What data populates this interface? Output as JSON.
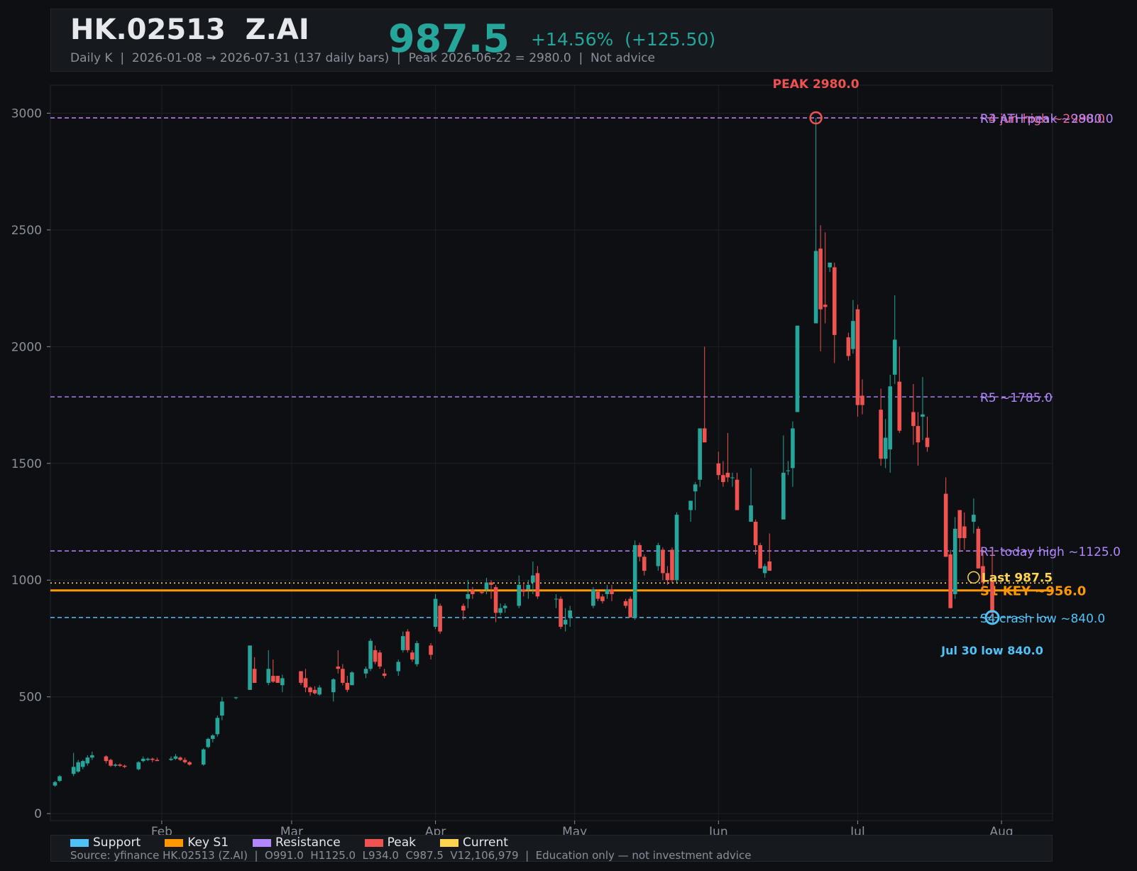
{
  "header": {
    "ticker": "HK.02513  Z.AI",
    "price": "987.5",
    "change": "+14.56%  (+125.50)",
    "subtitle": "Daily K  |  2026-01-08 → 2026-07-31 (137 daily bars)  |  Peak 2026-06-22 = 2980.0  |  Not advice"
  },
  "colors": {
    "background": "#0d0f13",
    "panel": "#16191e",
    "up": "#26a69a",
    "down": "#ef5350",
    "support": "#4fc3f7",
    "key_s1": "#ff9800",
    "resistance": "#b388ff",
    "peak": "#ef5350",
    "current": "#ffd54f",
    "r_high": "#f06292"
  },
  "chart_data": {
    "type": "candlestick",
    "x_range": [
      "2026-01-08",
      "2026-08-12"
    ],
    "ylim": [
      -30,
      3120
    ],
    "yticks": [
      0,
      500,
      1000,
      1500,
      2000,
      2500,
      3000
    ],
    "xticks": [
      {
        "date": "2026-02-01",
        "label": "Feb"
      },
      {
        "date": "2026-03-01",
        "label": "Mar"
      },
      {
        "date": "2026-04-01",
        "label": "Apr"
      },
      {
        "date": "2026-05-01",
        "label": "May"
      },
      {
        "date": "2026-06-01",
        "label": "Jun"
      },
      {
        "date": "2026-07-01",
        "label": "Jul"
      },
      {
        "date": "2026-08-01",
        "label": "Aug"
      }
    ],
    "grid": true,
    "hlines": [
      {
        "label": "R4 jun high ~2980.0",
        "value": 2980,
        "color": "#f06292",
        "style": "dashed"
      },
      {
        "label": "R3 ATH peak ~2980.0",
        "value": 2980,
        "color": "#b388ff",
        "style": "dashed"
      },
      {
        "label": "R5 ~1785.0",
        "value": 1785,
        "color": "#b388ff",
        "style": "dashed"
      },
      {
        "label": "R1 today high ~1125.0",
        "value": 1125,
        "color": "#b388ff",
        "style": "dashed"
      },
      {
        "label": "S1 KEY ~956.0",
        "value": 956,
        "color": "#ff9800",
        "style": "solid"
      },
      {
        "label": "S4 crash low ~840.0",
        "value": 840,
        "color": "#4fc3f7",
        "style": "dashed"
      },
      {
        "label": "",
        "value": 987.5,
        "color": "#ffd54f",
        "style": "dotted"
      }
    ],
    "annotations": [
      {
        "text": "PEAK 2980.0",
        "date": "2026-06-22",
        "value": 2980,
        "color": "#ef5350"
      },
      {
        "text": "Jul 30 low 840.0",
        "date": "2026-07-30",
        "value": 840,
        "color": "#4fc3f7"
      },
      {
        "text": "Last 987.5",
        "date": "2026-07-26",
        "value": 987.5,
        "color": "#ffd54f"
      }
    ],
    "candles": [
      [
        "2026-01-09",
        120,
        140,
        115,
        135
      ],
      [
        "2026-01-10",
        140,
        165,
        135,
        160
      ],
      [
        "2026-01-13",
        170,
        260,
        160,
        200
      ],
      [
        "2026-01-14",
        180,
        230,
        175,
        220
      ],
      [
        "2026-01-15",
        200,
        230,
        190,
        225
      ],
      [
        "2026-01-16",
        215,
        250,
        205,
        240
      ],
      [
        "2026-01-17",
        240,
        265,
        230,
        250
      ],
      [
        "2026-01-20",
        245,
        250,
        215,
        225
      ],
      [
        "2026-01-21",
        230,
        235,
        200,
        205
      ],
      [
        "2026-01-22",
        205,
        215,
        200,
        210
      ],
      [
        "2026-01-23",
        210,
        215,
        200,
        205
      ],
      [
        "2026-01-24",
        205,
        210,
        195,
        200
      ],
      [
        "2026-01-27",
        190,
        225,
        185,
        220
      ],
      [
        "2026-01-28",
        225,
        245,
        220,
        235
      ],
      [
        "2026-01-29",
        230,
        240,
        225,
        235
      ],
      [
        "2026-01-30",
        235,
        240,
        220,
        230
      ],
      [
        "2026-01-31",
        230,
        240,
        225,
        225
      ],
      [
        "2026-02-03",
        230,
        245,
        225,
        235
      ],
      [
        "2026-02-04",
        235,
        255,
        230,
        245
      ],
      [
        "2026-02-05",
        240,
        245,
        225,
        230
      ],
      [
        "2026-02-06",
        230,
        240,
        215,
        220
      ],
      [
        "2026-02-07",
        220,
        225,
        205,
        210
      ],
      [
        "2026-02-10",
        210,
        280,
        205,
        275
      ],
      [
        "2026-02-11",
        285,
        325,
        280,
        320
      ],
      [
        "2026-02-12",
        320,
        340,
        305,
        335
      ],
      [
        "2026-02-13",
        340,
        420,
        330,
        410
      ],
      [
        "2026-02-14",
        420,
        500,
        400,
        480
      ],
      [
        "2026-02-17",
        495,
        500,
        490,
        498
      ],
      [
        "2026-02-20",
        530,
        720,
        530,
        720
      ],
      [
        "2026-02-21",
        620,
        670,
        560,
        560
      ],
      [
        "2026-02-24",
        560,
        700,
        550,
        620
      ],
      [
        "2026-02-25",
        590,
        660,
        560,
        565
      ],
      [
        "2026-02-26",
        590,
        590,
        560,
        560
      ],
      [
        "2026-02-27",
        550,
        595,
        520,
        580
      ],
      [
        "2026-03-03",
        610,
        610,
        550,
        560
      ],
      [
        "2026-03-04",
        580,
        620,
        520,
        540
      ],
      [
        "2026-03-05",
        540,
        545,
        505,
        520
      ],
      [
        "2026-03-06",
        530,
        545,
        510,
        515
      ],
      [
        "2026-03-07",
        510,
        550,
        505,
        540
      ],
      [
        "2026-03-10",
        520,
        580,
        480,
        575
      ],
      [
        "2026-03-11",
        630,
        700,
        600,
        620
      ],
      [
        "2026-03-12",
        620,
        640,
        550,
        560
      ],
      [
        "2026-03-13",
        560,
        590,
        520,
        530
      ],
      [
        "2026-03-14",
        550,
        610,
        550,
        605
      ],
      [
        "2026-03-17",
        600,
        630,
        580,
        620
      ],
      [
        "2026-03-18",
        620,
        750,
        610,
        740
      ],
      [
        "2026-03-19",
        700,
        720,
        640,
        650
      ],
      [
        "2026-03-20",
        690,
        700,
        620,
        630
      ],
      [
        "2026-03-21",
        600,
        620,
        580,
        590
      ],
      [
        "2026-03-24",
        610,
        660,
        590,
        650
      ],
      [
        "2026-03-25",
        700,
        780,
        690,
        760
      ],
      [
        "2026-03-26",
        780,
        790,
        690,
        700
      ],
      [
        "2026-03-27",
        690,
        700,
        650,
        660
      ],
      [
        "2026-03-28",
        640,
        740,
        630,
        730
      ],
      [
        "2026-03-31",
        720,
        730,
        660,
        680
      ],
      [
        "2026-04-01",
        800,
        940,
        790,
        920
      ],
      [
        "2026-04-02",
        890,
        900,
        770,
        780
      ],
      [
        "2026-04-07",
        890,
        900,
        830,
        870
      ],
      [
        "2026-04-08",
        920,
        1000,
        880,
        940
      ],
      [
        "2026-04-09",
        960,
        970,
        920,
        940
      ],
      [
        "2026-04-11",
        950,
        960,
        940,
        945
      ],
      [
        "2026-04-12",
        960,
        1010,
        940,
        990
      ],
      [
        "2026-04-13",
        990,
        1000,
        920,
        980
      ],
      [
        "2026-04-14",
        970,
        980,
        820,
        860
      ],
      [
        "2026-04-15",
        860,
        900,
        850,
        880
      ],
      [
        "2026-04-16",
        880,
        900,
        860,
        890
      ],
      [
        "2026-04-19",
        890,
        1020,
        880,
        980
      ],
      [
        "2026-04-20",
        960,
        990,
        930,
        950
      ],
      [
        "2026-04-21",
        960,
        1000,
        920,
        980
      ],
      [
        "2026-04-22",
        990,
        1080,
        940,
        1020
      ],
      [
        "2026-04-23",
        1030,
        1060,
        920,
        930
      ],
      [
        "2026-04-27",
        920,
        940,
        880,
        920
      ],
      [
        "2026-04-28",
        920,
        930,
        790,
        800
      ],
      [
        "2026-04-29",
        810,
        880,
        780,
        830
      ],
      [
        "2026-04-30",
        840,
        890,
        800,
        870
      ],
      [
        "2026-05-05",
        890,
        970,
        880,
        960
      ],
      [
        "2026-05-06",
        950,
        960,
        910,
        920
      ],
      [
        "2026-05-07",
        930,
        940,
        900,
        910
      ],
      [
        "2026-05-08",
        940,
        980,
        920,
        960
      ],
      [
        "2026-05-09",
        960,
        980,
        910,
        940
      ],
      [
        "2026-05-12",
        910,
        920,
        880,
        890
      ],
      [
        "2026-05-13",
        920,
        930,
        840,
        840
      ],
      [
        "2026-05-14",
        840,
        1170,
        830,
        1150
      ],
      [
        "2026-05-15",
        1150,
        1160,
        1080,
        1100
      ],
      [
        "2026-05-16",
        1100,
        1110,
        1020,
        1040
      ],
      [
        "2026-05-19",
        1060,
        1160,
        1040,
        1150
      ],
      [
        "2026-05-20",
        1130,
        1140,
        1000,
        1030
      ],
      [
        "2026-05-21",
        1030,
        1060,
        980,
        1000
      ],
      [
        "2026-05-22",
        1130,
        1140,
        990,
        1000
      ],
      [
        "2026-05-23",
        1000,
        1290,
        990,
        1280
      ],
      [
        "2026-05-26",
        1300,
        1340,
        1250,
        1340
      ],
      [
        "2026-05-27",
        1380,
        1420,
        1300,
        1410
      ],
      [
        "2026-05-28",
        1430,
        1640,
        1400,
        1650
      ],
      [
        "2026-05-29",
        1650,
        2000,
        1600,
        1590
      ],
      [
        "2026-06-01",
        1500,
        1550,
        1430,
        1450
      ],
      [
        "2026-06-02",
        1450,
        1510,
        1400,
        1420
      ],
      [
        "2026-06-03",
        1460,
        1630,
        1420,
        1440
      ],
      [
        "2026-06-04",
        1440,
        1460,
        1400,
        1440
      ],
      [
        "2026-06-05",
        1430,
        1460,
        1300,
        1300
      ],
      [
        "2026-06-08",
        1250,
        1480,
        1250,
        1320
      ],
      [
        "2026-06-09",
        1250,
        1260,
        1110,
        1150
      ],
      [
        "2026-06-10",
        1150,
        1160,
        1050,
        1050
      ],
      [
        "2026-06-11",
        1030,
        1070,
        1010,
        1060
      ],
      [
        "2026-06-12",
        1080,
        1200,
        1040,
        1040
      ],
      [
        "2026-06-15",
        1260,
        1620,
        1260,
        1460
      ],
      [
        "2026-06-16",
        1470,
        1510,
        1450,
        1470
      ],
      [
        "2026-06-17",
        1480,
        1680,
        1400,
        1650
      ],
      [
        "2026-06-18",
        1720,
        2090,
        1720,
        2090
      ],
      [
        "2026-06-22",
        2100,
        2980,
        2100,
        2410
      ],
      [
        "2026-06-23",
        2420,
        2520,
        1980,
        2160
      ],
      [
        "2026-06-24",
        2180,
        2490,
        2100,
        2170
      ],
      [
        "2026-06-25",
        2340,
        2360,
        2320,
        2360
      ],
      [
        "2026-06-26",
        2340,
        2360,
        1930,
        2050
      ],
      [
        "2026-06-29",
        2040,
        2060,
        1940,
        1960
      ],
      [
        "2026-06-30",
        1990,
        2200,
        1970,
        2110
      ],
      [
        "2026-07-01",
        2160,
        2180,
        1700,
        1750
      ],
      [
        "2026-07-02",
        1790,
        1860,
        1710,
        1750
      ],
      [
        "2026-07-06",
        1730,
        1820,
        1490,
        1520
      ],
      [
        "2026-07-07",
        1520,
        1690,
        1480,
        1610
      ],
      [
        "2026-07-08",
        1560,
        1880,
        1460,
        1830
      ],
      [
        "2026-07-09",
        1880,
        2220,
        1840,
        2030
      ],
      [
        "2026-07-10",
        1850,
        2000,
        1630,
        1640
      ],
      [
        "2026-07-13",
        1720,
        1840,
        1580,
        1660
      ],
      [
        "2026-07-14",
        1660,
        1720,
        1490,
        1590
      ],
      [
        "2026-07-15",
        1700,
        1870,
        1600,
        1710
      ],
      [
        "2026-07-16",
        1610,
        1700,
        1550,
        1570
      ],
      [
        "2026-07-20",
        1370,
        1440,
        1100,
        1100
      ],
      [
        "2026-07-21",
        1110,
        1130,
        880,
        880
      ],
      [
        "2026-07-22",
        940,
        1270,
        920,
        1220
      ],
      [
        "2026-07-23",
        1300,
        1300,
        1120,
        1180
      ],
      [
        "2026-07-24",
        1230,
        1290,
        1130,
        1180
      ],
      [
        "2026-07-26",
        1250,
        1350,
        1200,
        1280
      ],
      [
        "2026-07-27",
        1220,
        1230,
        1050,
        1050
      ],
      [
        "2026-07-28",
        1060,
        1130,
        950,
        990
      ],
      [
        "2026-07-30",
        1000,
        1130,
        840,
        860
      ]
    ]
  },
  "footer": {
    "legend": [
      {
        "label": "Support",
        "color": "#4fc3f7"
      },
      {
        "label": "Key S1",
        "color": "#ff9800"
      },
      {
        "label": "Resistance",
        "color": "#b388ff"
      },
      {
        "label": "Peak",
        "color": "#ef5350"
      },
      {
        "label": "Current",
        "color": "#ffd54f"
      }
    ],
    "source": "Source: yfinance HK.02513 (Z.AI)  |  O991.0  H1125.0  L934.0  C987.5  V12,106,979  |  Education only — not investment advice"
  }
}
